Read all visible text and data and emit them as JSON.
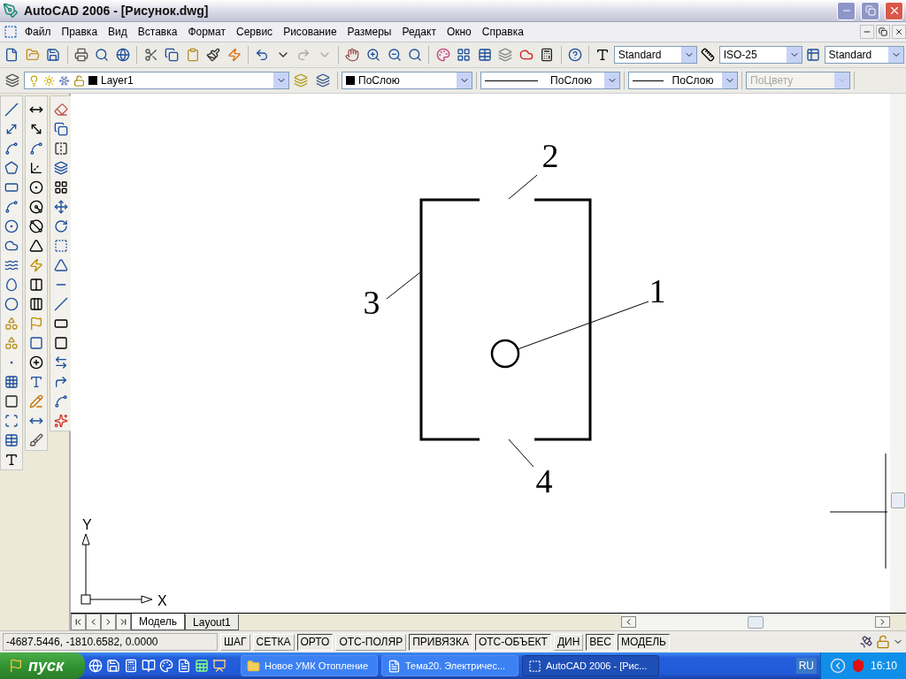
{
  "window": {
    "title": "AutoCAD 2006 - [Рисунок.dwg]"
  },
  "menu": [
    "Файл",
    "Правка",
    "Вид",
    "Вставка",
    "Формат",
    "Сервис",
    "Рисование",
    "Размеры",
    "Редакт",
    "Окно",
    "Справка"
  ],
  "styles_toolbar": {
    "text_style": "Standard",
    "dim_style": "ISO-25",
    "table_style": "Standard"
  },
  "layers_toolbar": {
    "layer": "Layer1"
  },
  "properties_toolbar": [
    {
      "kind": "color",
      "value": "ПоСлою",
      "disabled": false
    },
    {
      "kind": "linetype",
      "value": "ПоСлою",
      "disabled": false
    },
    {
      "kind": "lineweight",
      "value": "ПоСлою",
      "disabled": false
    },
    {
      "kind": "plotstyle",
      "value": "ПоЦвету",
      "disabled": true
    }
  ],
  "drawing": {
    "callouts": [
      "1",
      "2",
      "3",
      "4"
    ],
    "ucs": {
      "x_label": "X",
      "y_label": "Y"
    }
  },
  "layout_tabs": [
    {
      "label": "Модель",
      "selected": true
    },
    {
      "label": "Layout1",
      "selected": false
    }
  ],
  "status_bar": {
    "coordinates": "-4687.5446, -1810.6582, 0.0000",
    "toggles": [
      {
        "label": "ШАГ",
        "on": false
      },
      {
        "label": "СЕТКА",
        "on": false
      },
      {
        "label": "ОРТО",
        "on": true
      },
      {
        "label": "ОТС-ПОЛЯР",
        "on": false
      },
      {
        "label": "ПРИВЯЗКА",
        "on": true
      },
      {
        "label": "ОТС-ОБЪЕКТ",
        "on": true
      },
      {
        "label": "ДИН",
        "on": false
      },
      {
        "label": "ВЕС",
        "on": true
      },
      {
        "label": "МОДЕЛЬ",
        "on": true
      }
    ]
  },
  "taskbar": {
    "start": "пуск",
    "tasks": [
      {
        "kind": "folder",
        "label": "Новое УМК Отопление",
        "selected": false
      },
      {
        "kind": "word",
        "label": "Тема20. Электричес...",
        "selected": false
      },
      {
        "kind": "autocad",
        "label": "AutoCAD 2006 - [Рис...",
        "selected": true
      }
    ],
    "language": "RU",
    "clock": "16:10"
  }
}
